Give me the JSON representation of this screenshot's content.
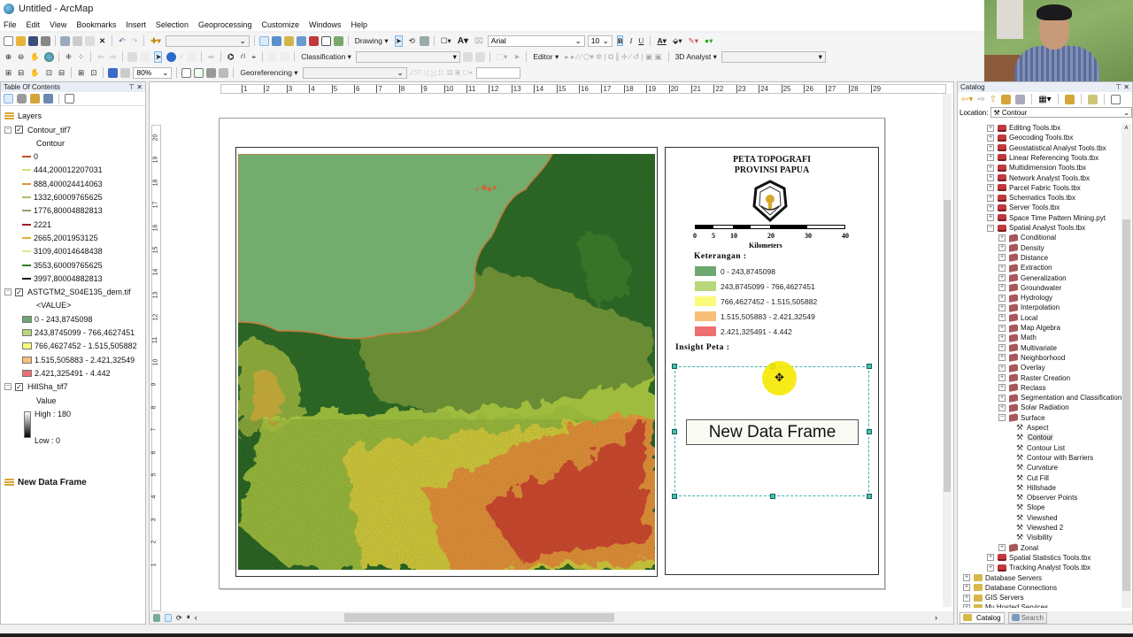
{
  "window": {
    "title": "Untitled - ArcMap"
  },
  "menu": [
    "File",
    "Edit",
    "View",
    "Bookmarks",
    "Insert",
    "Selection",
    "Geoprocessing",
    "Customize",
    "Windows",
    "Help"
  ],
  "toolbars": {
    "drawing_label": "Drawing",
    "font_name": "Arial",
    "font_size": "10",
    "bold": "B",
    "italic": "I",
    "underline": "U",
    "classification_label": "Classification",
    "editor_label": "Editor",
    "analyst3d_label": "3D Analyst",
    "georeferencing_label": "Georeferencing",
    "zoom_level": "80%"
  },
  "toc": {
    "title": "Table Of Contents",
    "root": "Layers",
    "layers": [
      {
        "name": "Contour_tif7",
        "checked": true,
        "field": "Contour",
        "classes": [
          {
            "label": "0",
            "color": "#c8502a"
          },
          {
            "label": "444,200012207031",
            "color": "#d8dc7a"
          },
          {
            "label": "888,400024414063",
            "color": "#d99a3a"
          },
          {
            "label": "1332,60009765625",
            "color": "#a8c46a"
          },
          {
            "label": "1776,80004882813",
            "color": "#8fa070"
          },
          {
            "label": "2221",
            "color": "#a0202a"
          },
          {
            "label": "2665,2001953125",
            "color": "#e0b030"
          },
          {
            "label": "3109,40014648438",
            "color": "#e2e690"
          },
          {
            "label": "3553,60009765625",
            "color": "#3a7a20"
          },
          {
            "label": "3997,80004882813",
            "color": "#1a1a1a"
          }
        ]
      },
      {
        "name": "ASTGTM2_S04E135_dem.tif",
        "checked": true,
        "field": "<VALUE>",
        "classes": [
          {
            "label": "0 - 243,8745098",
            "color": "#6fa870"
          },
          {
            "label": "243,8745099 - 766,4627451",
            "color": "#b7d77a"
          },
          {
            "label": "766,4627452 - 1.515,505882",
            "color": "#fafa7a"
          },
          {
            "label": "1.515,505883 - 2.421,32549",
            "color": "#f6c07a"
          },
          {
            "label": "2.421,325491 - 4.442",
            "color": "#ee6f6f"
          }
        ]
      },
      {
        "name": "HillSha_tif7",
        "checked": true,
        "field": "Value",
        "high": "High : 180",
        "low": "Low : 0"
      }
    ],
    "data_frame_2": "New Data Frame"
  },
  "ruler": {
    "h": [
      "1",
      "2",
      "3",
      "4",
      "5",
      "6",
      "7",
      "8",
      "9",
      "10",
      "11",
      "12",
      "13",
      "14",
      "15",
      "16",
      "17",
      "18",
      "19",
      "20",
      "21",
      "22",
      "23",
      "24",
      "25",
      "26",
      "27",
      "28",
      "29"
    ],
    "v": [
      "20",
      "19",
      "18",
      "17",
      "16",
      "15",
      "14",
      "13",
      "12",
      "11",
      "10",
      "9",
      "8",
      "7",
      "6",
      "5",
      "4",
      "3",
      "2",
      "1"
    ]
  },
  "layout": {
    "title_line1": "PETA TOPOGRAFI",
    "title_line2": "PROVINSI PAPUA",
    "scale_labels": [
      "0",
      "5",
      "10",
      "20",
      "30",
      "40"
    ],
    "scale_unit": "Kilometers",
    "legend_heading": "Keterangan :",
    "legend_items": [
      {
        "label": "0 - 243,8745098",
        "color": "#6fa870"
      },
      {
        "label": "243,8745099 - 766,4627451",
        "color": "#b7d77a"
      },
      {
        "label": "766,4627452 - 1.515,505882",
        "color": "#fafa7a"
      },
      {
        "label": "1.515,505883 - 2.421,32549",
        "color": "#f6c07a"
      },
      {
        "label": "2.421,325491 - 4.442",
        "color": "#ee6f6f"
      }
    ],
    "inset_heading": "Insight Peta :",
    "new_data_frame_label": "New Data Frame"
  },
  "catalog": {
    "title": "Catalog",
    "location_label": "Location:",
    "location_value": "Contour",
    "items": [
      {
        "label": "Editing Tools.tbx",
        "type": "tbx",
        "level": 2,
        "exp": "+"
      },
      {
        "label": "Geocoding Tools.tbx",
        "type": "tbx",
        "level": 2,
        "exp": "+"
      },
      {
        "label": "Geostatistical Analyst Tools.tbx",
        "type": "tbx",
        "level": 2,
        "exp": "+"
      },
      {
        "label": "Linear Referencing Tools.tbx",
        "type": "tbx",
        "level": 2,
        "exp": "+"
      },
      {
        "label": "Multidimension Tools.tbx",
        "type": "tbx",
        "level": 2,
        "exp": "+"
      },
      {
        "label": "Network Analyst Tools.tbx",
        "type": "tbx",
        "level": 2,
        "exp": "+"
      },
      {
        "label": "Parcel Fabric Tools.tbx",
        "type": "tbx",
        "level": 2,
        "exp": "+"
      },
      {
        "label": "Schematics Tools.tbx",
        "type": "tbx",
        "level": 2,
        "exp": "+"
      },
      {
        "label": "Server Tools.tbx",
        "type": "tbx",
        "level": 2,
        "exp": "+"
      },
      {
        "label": "Space Time Pattern Mining.pyt",
        "type": "tbx",
        "level": 2,
        "exp": "+"
      },
      {
        "label": "Spatial Analyst Tools.tbx",
        "type": "tbx",
        "level": 2,
        "exp": "-"
      },
      {
        "label": "Conditional",
        "type": "tset",
        "level": 3,
        "exp": "+"
      },
      {
        "label": "Density",
        "type": "tset",
        "level": 3,
        "exp": "+"
      },
      {
        "label": "Distance",
        "type": "tset",
        "level": 3,
        "exp": "+"
      },
      {
        "label": "Extraction",
        "type": "tset",
        "level": 3,
        "exp": "+"
      },
      {
        "label": "Generalization",
        "type": "tset",
        "level": 3,
        "exp": "+"
      },
      {
        "label": "Groundwater",
        "type": "tset",
        "level": 3,
        "exp": "+"
      },
      {
        "label": "Hydrology",
        "type": "tset",
        "level": 3,
        "exp": "+"
      },
      {
        "label": "Interpolation",
        "type": "tset",
        "level": 3,
        "exp": "+"
      },
      {
        "label": "Local",
        "type": "tset",
        "level": 3,
        "exp": "+"
      },
      {
        "label": "Map Algebra",
        "type": "tset",
        "level": 3,
        "exp": "+"
      },
      {
        "label": "Math",
        "type": "tset",
        "level": 3,
        "exp": "+"
      },
      {
        "label": "Multivariate",
        "type": "tset",
        "level": 3,
        "exp": "+"
      },
      {
        "label": "Neighborhood",
        "type": "tset",
        "level": 3,
        "exp": "+"
      },
      {
        "label": "Overlay",
        "type": "tset",
        "level": 3,
        "exp": "+"
      },
      {
        "label": "Raster Creation",
        "type": "tset",
        "level": 3,
        "exp": "+"
      },
      {
        "label": "Reclass",
        "type": "tset",
        "level": 3,
        "exp": "+"
      },
      {
        "label": "Segmentation and Classification",
        "type": "tset",
        "level": 3,
        "exp": "+"
      },
      {
        "label": "Solar Radiation",
        "type": "tset",
        "level": 3,
        "exp": "+"
      },
      {
        "label": "Surface",
        "type": "tset",
        "level": 3,
        "exp": "-"
      },
      {
        "label": "Aspect",
        "type": "tool",
        "level": 4
      },
      {
        "label": "Contour",
        "type": "tool",
        "level": 4,
        "selected": true
      },
      {
        "label": "Contour List",
        "type": "tool",
        "level": 4
      },
      {
        "label": "Contour with Barriers",
        "type": "tool",
        "level": 4
      },
      {
        "label": "Curvature",
        "type": "tool",
        "level": 4
      },
      {
        "label": "Cut Fill",
        "type": "tool",
        "level": 4
      },
      {
        "label": "Hillshade",
        "type": "tool",
        "level": 4
      },
      {
        "label": "Observer Points",
        "type": "tool",
        "level": 4
      },
      {
        "label": "Slope",
        "type": "tool",
        "level": 4
      },
      {
        "label": "Viewshed",
        "type": "tool",
        "level": 4
      },
      {
        "label": "Viewshed 2",
        "type": "tool",
        "level": 4
      },
      {
        "label": "Visibility",
        "type": "tool",
        "level": 4
      },
      {
        "label": "Zonal",
        "type": "tset",
        "level": 3,
        "exp": "+"
      },
      {
        "label": "Spatial Statistics Tools.tbx",
        "type": "tbx",
        "level": 2,
        "exp": "+"
      },
      {
        "label": "Tracking Analyst Tools.tbx",
        "type": "tbx",
        "level": 2,
        "exp": "+"
      },
      {
        "label": "Database Servers",
        "type": "folder",
        "level": 0,
        "exp": "+"
      },
      {
        "label": "Database Connections",
        "type": "folder",
        "level": 0,
        "exp": "+"
      },
      {
        "label": "GIS Servers",
        "type": "folder",
        "level": 0,
        "exp": "+"
      },
      {
        "label": "My Hosted Services",
        "type": "folder",
        "level": 0,
        "exp": "+"
      }
    ],
    "tabs": [
      "Catalog",
      "Search"
    ]
  }
}
